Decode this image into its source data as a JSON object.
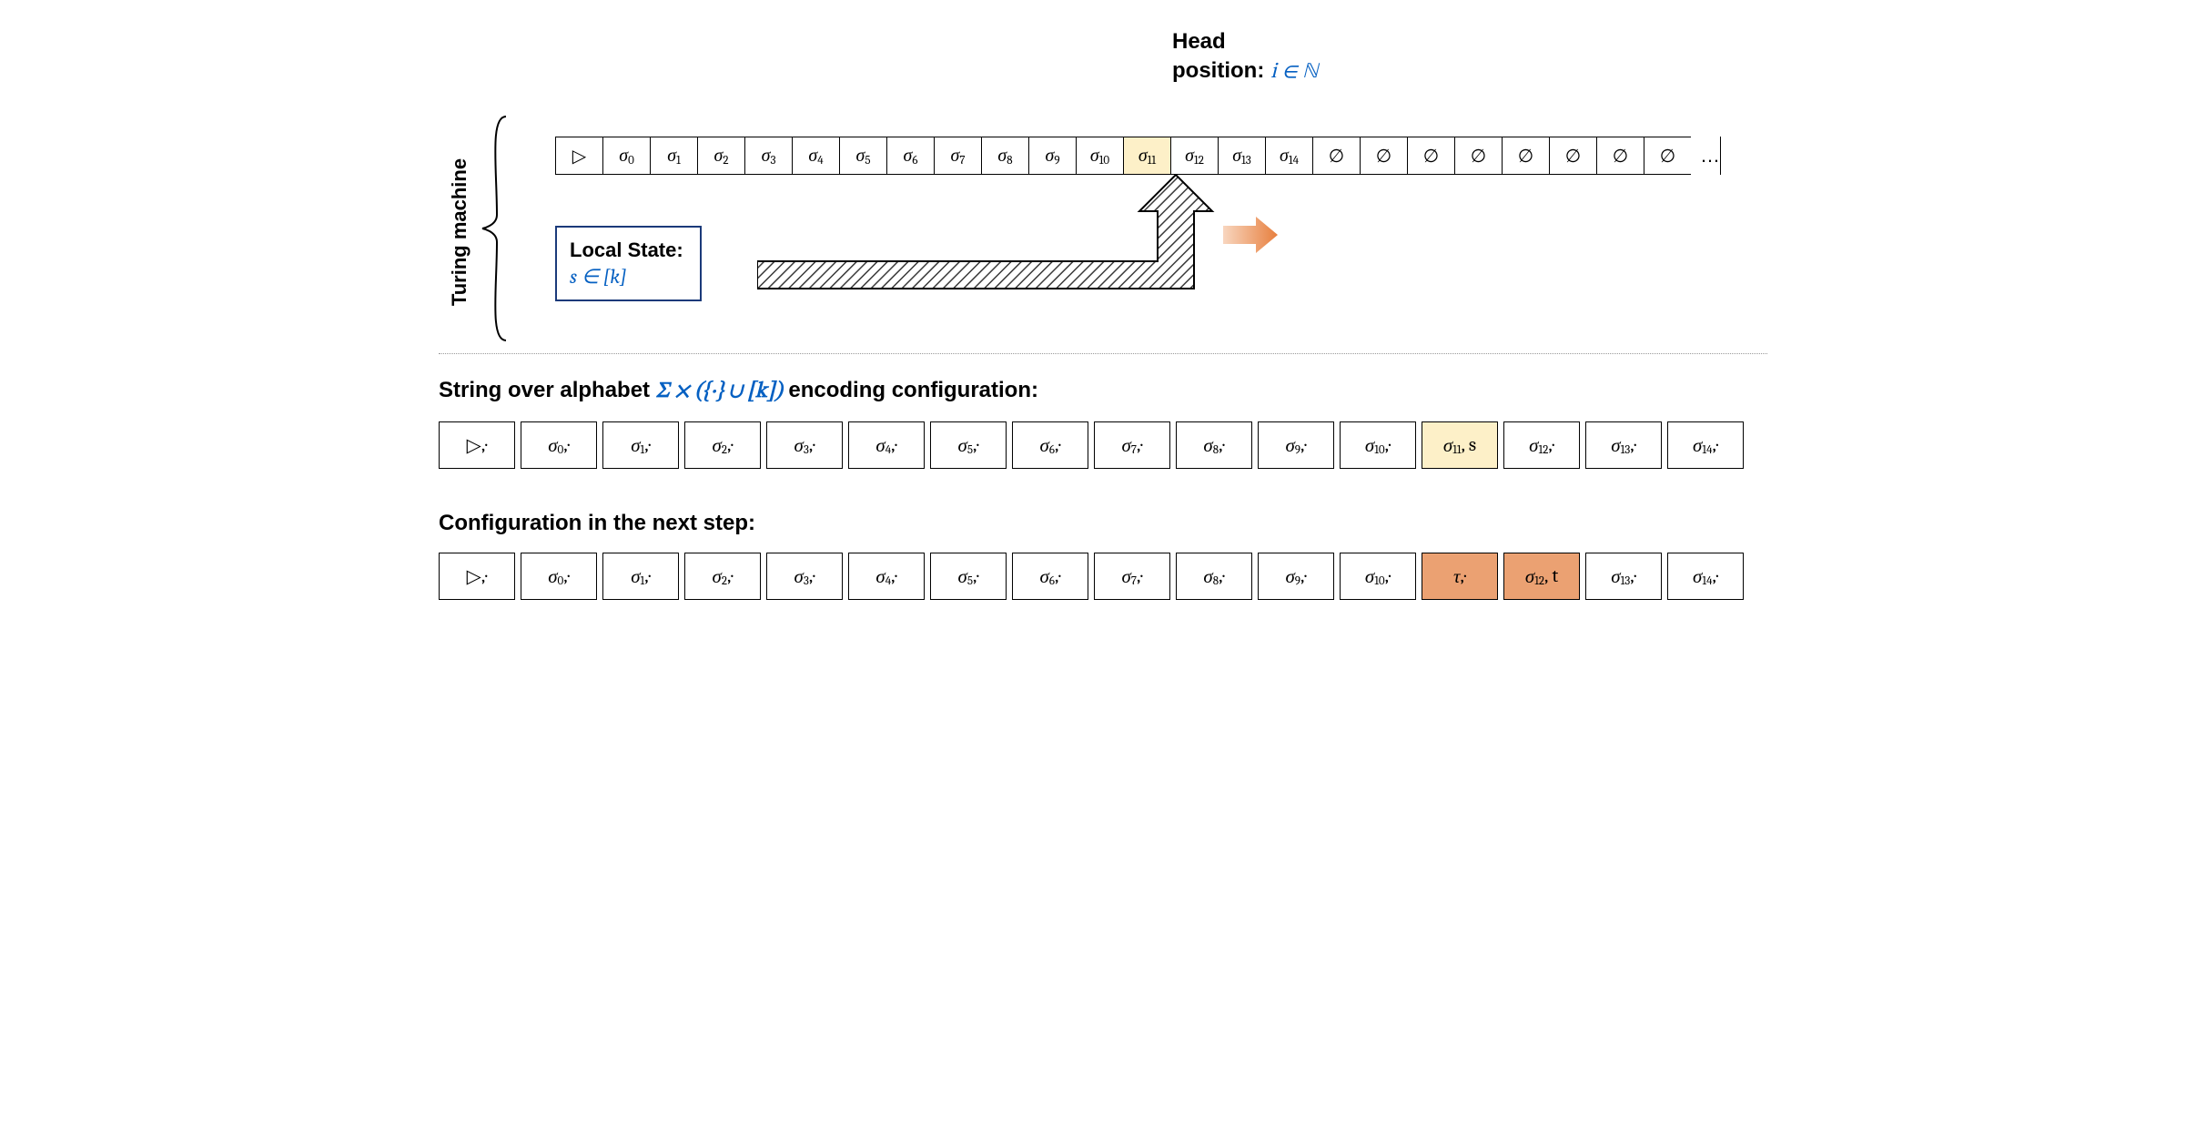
{
  "vertical_label": "Turing machine",
  "head_label": {
    "line1": "Head",
    "line2_prefix": "position: ",
    "line2_math": "i ∈ ℕ"
  },
  "local_state": {
    "title": "Local State:",
    "math": "s ∈ [k]"
  },
  "tape_top": {
    "cells": [
      {
        "t": "▷",
        "sub": ""
      },
      {
        "t": "σ",
        "sub": "0"
      },
      {
        "t": "σ",
        "sub": "1"
      },
      {
        "t": "σ",
        "sub": "2"
      },
      {
        "t": "σ",
        "sub": "3"
      },
      {
        "t": "σ",
        "sub": "4"
      },
      {
        "t": "σ",
        "sub": "5"
      },
      {
        "t": "σ",
        "sub": "6"
      },
      {
        "t": "σ",
        "sub": "7"
      },
      {
        "t": "σ",
        "sub": "8"
      },
      {
        "t": "σ",
        "sub": "9"
      },
      {
        "t": "σ",
        "sub": "10"
      },
      {
        "t": "σ",
        "sub": "11",
        "hl": true
      },
      {
        "t": "σ",
        "sub": "12"
      },
      {
        "t": "σ",
        "sub": "13"
      },
      {
        "t": "σ",
        "sub": "14"
      },
      {
        "t": "∅",
        "sub": ""
      },
      {
        "t": "∅",
        "sub": ""
      },
      {
        "t": "∅",
        "sub": ""
      },
      {
        "t": "∅",
        "sub": ""
      },
      {
        "t": "∅",
        "sub": ""
      },
      {
        "t": "∅",
        "sub": ""
      },
      {
        "t": "∅",
        "sub": ""
      },
      {
        "t": "∅",
        "sub": ""
      }
    ],
    "ellipsis": "…"
  },
  "section1": {
    "prefix": "String over alphabet  ",
    "math": "Σ × ({·} ∪ [k])",
    "suffix": " encoding configuration:"
  },
  "row1": [
    {
      "t": "▷",
      "sub": "",
      "suf": ",·"
    },
    {
      "t": "σ",
      "sub": "0",
      "suf": ",·"
    },
    {
      "t": "σ",
      "sub": "1",
      "suf": ",·"
    },
    {
      "t": "σ",
      "sub": "2",
      "suf": ",·"
    },
    {
      "t": "σ",
      "sub": "3",
      "suf": ",·"
    },
    {
      "t": "σ",
      "sub": "4",
      "suf": ",·"
    },
    {
      "t": "σ",
      "sub": "5",
      "suf": ",·"
    },
    {
      "t": "σ",
      "sub": "6",
      "suf": ",·"
    },
    {
      "t": "σ",
      "sub": "7",
      "suf": ",·"
    },
    {
      "t": "σ",
      "sub": "8",
      "suf": ",·"
    },
    {
      "t": "σ",
      "sub": "9",
      "suf": ",·"
    },
    {
      "t": "σ",
      "sub": "10",
      "suf": ",·"
    },
    {
      "t": "σ",
      "sub": "11",
      "suf": ", s",
      "hl": "y"
    },
    {
      "t": "σ",
      "sub": "12",
      "suf": ",·"
    },
    {
      "t": "σ",
      "sub": "13",
      "suf": ",·"
    },
    {
      "t": "σ",
      "sub": "14",
      "suf": ",·"
    }
  ],
  "section2": "Configuration in the next step:",
  "row2": [
    {
      "t": "▷",
      "sub": "",
      "suf": ",·"
    },
    {
      "t": "σ",
      "sub": "0",
      "suf": ",·"
    },
    {
      "t": "σ",
      "sub": "1",
      "suf": ",·"
    },
    {
      "t": "σ",
      "sub": "2",
      "suf": ",·"
    },
    {
      "t": "σ",
      "sub": "3",
      "suf": ",·"
    },
    {
      "t": "σ",
      "sub": "4",
      "suf": ",·"
    },
    {
      "t": "σ",
      "sub": "5",
      "suf": ",·"
    },
    {
      "t": "σ",
      "sub": "6",
      "suf": ",·"
    },
    {
      "t": "σ",
      "sub": "7",
      "suf": ",·"
    },
    {
      "t": "σ",
      "sub": "8",
      "suf": ",·"
    },
    {
      "t": "σ",
      "sub": "9",
      "suf": ",·"
    },
    {
      "t": "σ",
      "sub": "10",
      "suf": ",·"
    },
    {
      "t": "τ",
      "sub": "",
      "suf": ",·",
      "hl": "o1"
    },
    {
      "t": "σ",
      "sub": "12",
      "suf": ", t",
      "hl": "o2"
    },
    {
      "t": "σ",
      "sub": "13",
      "suf": ",·"
    },
    {
      "t": "σ",
      "sub": "14",
      "suf": ",·"
    }
  ]
}
